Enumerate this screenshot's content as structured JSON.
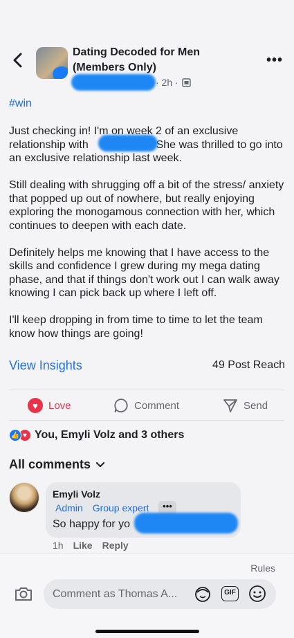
{
  "header": {
    "group_title": "Dating Decoded for Men (Members Only)",
    "time": "· 2h ·",
    "more_label": "•••"
  },
  "post": {
    "hashtag": "#win",
    "paragraphs": [
      "Just checking in! I'm on week 2 of an exclusive relationship with                      She was thrilled to go into an exclusive relationship last week.",
      "Still dealing with shrugging off a bit of the stress/ anxiety that popped up out of nowhere, but really enjoying exploring the monogamous connection with her, which continues to deepen with each date.",
      "Definitely helps me knowing that I have access to the skills and confidence I grew during my mega dating phase, and that if things don't work out I can walk away knowing I can pick back up where I left off.",
      "I'll keep dropping in from time to time to let the team know how things are going!"
    ],
    "view_insights": "View Insights",
    "post_reach": "49 Post Reach"
  },
  "actions": {
    "love": "Love",
    "comment": "Comment",
    "send": "Send"
  },
  "reactions": {
    "summary": "You, Emyli Volz and 3 others"
  },
  "comments": {
    "header": "All comments",
    "items": [
      {
        "author": "Emyli Volz",
        "badge_admin": "Admin",
        "badge_expert": "Group expert",
        "more": "•••",
        "text": "So happy for yo",
        "time": "1h",
        "like": "Like",
        "reply": "Reply"
      }
    ]
  },
  "footer": {
    "rules": "Rules",
    "input_placeholder": "Comment as Thomas A...",
    "gif_label": "GIF"
  },
  "colors": {
    "accent": "#216fdb",
    "love": "#e8334a",
    "redaction": "#1f87f4"
  }
}
